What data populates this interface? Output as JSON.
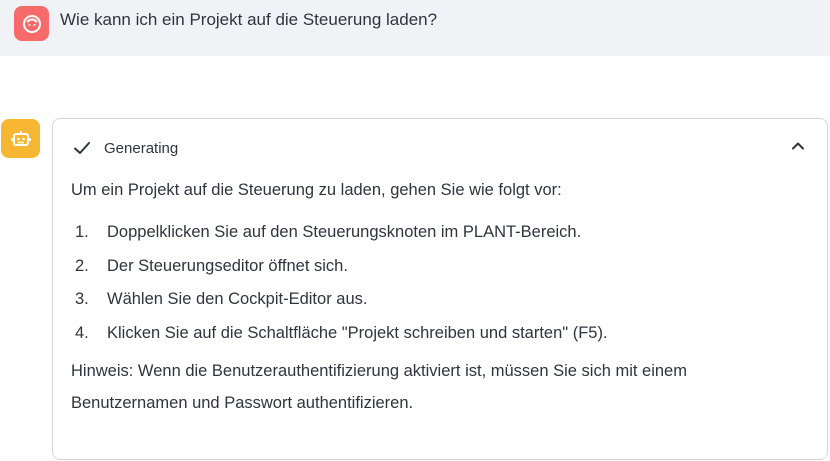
{
  "user_message": {
    "avatar_icon": "user-face-icon",
    "text": "Wie kann ich ein Projekt auf die Steuerung laden?"
  },
  "assistant": {
    "avatar_icon": "robot-icon",
    "status": {
      "icon": "check-icon",
      "label": "Generating",
      "toggle_icon": "chevron-up-icon"
    },
    "intro": "Um ein Projekt auf die Steuerung zu laden, gehen Sie wie folgt vor:",
    "steps": [
      {
        "num": "1.",
        "text": "Doppelklicken Sie auf den Steuerungsknoten im PLANT-Bereich."
      },
      {
        "num": "2.",
        "text": "Der Steuerungseditor öffnet sich."
      },
      {
        "num": "3.",
        "text": "Wählen Sie den Cockpit-Editor aus."
      },
      {
        "num": "4.",
        "text": "Klicken Sie auf die Schaltfläche \"Projekt schreiben und starten\" (F5)."
      }
    ],
    "note": "Hinweis: Wenn die Benutzerauthentifizierung aktiviert ist, müssen Sie sich mit einem Benutzernamen und Passwort authentifizieren."
  },
  "colors": {
    "user_row_bg": "#f0f2f6",
    "user_avatar": "#f66a6a",
    "bot_avatar": "#f7b733",
    "text": "#31333f",
    "border": "#d6d8de"
  }
}
